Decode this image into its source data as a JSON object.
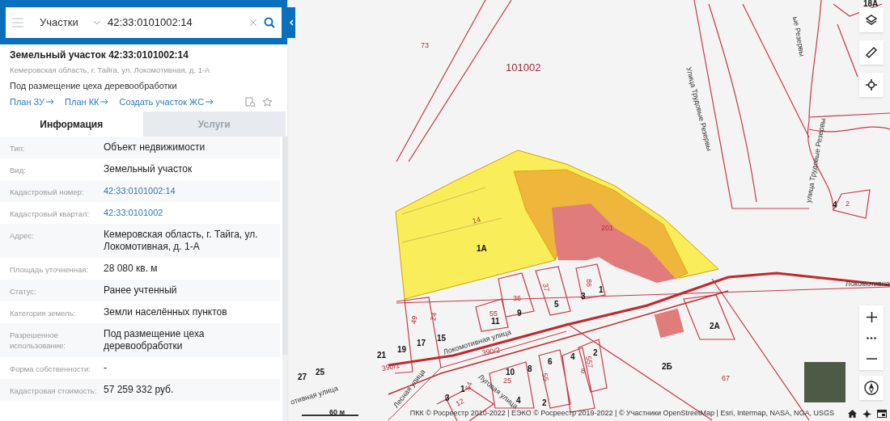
{
  "search": {
    "layer": "Участки",
    "value": "42:33:0101002:14"
  },
  "object": {
    "title": "Земельный участок 42:33:0101002:14",
    "address": "Кемеровская область, г. Тайга, ул. Локомотивная, д. 1-А",
    "purpose": "Под размещение цеха деревообработки",
    "links": [
      "План ЗУ",
      "План КК",
      "Создать участок ЖС"
    ]
  },
  "tabs": [
    {
      "label": "Информация",
      "selected": true
    },
    {
      "label": "Услуги",
      "selected": false
    }
  ],
  "details": [
    {
      "label": "Тип:",
      "value": "Объект недвижимости",
      "kind": "text"
    },
    {
      "label": "Вид:",
      "value": "Земельный участок",
      "kind": "text"
    },
    {
      "label": "Кадастровый номер:",
      "value": "42:33:0101002:14",
      "kind": "link"
    },
    {
      "label": "Кадастровый квартал:",
      "value": "42:33:0101002",
      "kind": "link"
    },
    {
      "label": "Адрес:",
      "value": "Кемеровская область, г. Тайга, ул. Локомотивная, д. 1-А",
      "kind": "text"
    },
    {
      "label": "Площадь уточненная:",
      "value": "28 080 кв. м",
      "kind": "text"
    },
    {
      "label": "Статус:",
      "value": "Ранее учтенный",
      "kind": "text"
    },
    {
      "label": "Категория земель:",
      "value": "Земли населённых пунктов",
      "kind": "text"
    },
    {
      "label": "Разрешенное использование:",
      "value": "Под размещение цеха деревообработки",
      "kind": "text"
    },
    {
      "label": "Форма собственности:",
      "value": "-",
      "kind": "text"
    },
    {
      "label": "Кадастровая стоимость:",
      "value": "57 259 332 руб.",
      "kind": "text"
    }
  ],
  "map": {
    "labels": [
      {
        "text": "73",
        "kind": "parcel"
      },
      {
        "text": "101002",
        "kind": "quarter"
      },
      {
        "text": "Улица Трудовые Резервы",
        "kind": "street"
      },
      {
        "text": "ые Резервы",
        "kind": "street"
      },
      {
        "text": "18А",
        "kind": "number"
      },
      {
        "text": "улица Трудовые Резервы",
        "kind": "street"
      },
      {
        "text": "4",
        "kind": "number"
      },
      {
        "text": "2",
        "kind": "parcel"
      },
      {
        "text": "14",
        "kind": "parcel"
      },
      {
        "text": "1А",
        "kind": "number"
      },
      {
        "text": "201",
        "kind": "parcel"
      },
      {
        "text": "37",
        "kind": "parcel"
      },
      {
        "text": "86",
        "kind": "parcel"
      },
      {
        "text": "1",
        "kind": "number"
      },
      {
        "text": "3",
        "kind": "number"
      },
      {
        "text": "5",
        "kind": "number"
      },
      {
        "text": "36",
        "kind": "parcel"
      },
      {
        "text": "9",
        "kind": "number"
      },
      {
        "text": "55",
        "kind": "parcel"
      },
      {
        "text": "11",
        "kind": "number"
      },
      {
        "text": "49",
        "kind": "parcel"
      },
      {
        "text": "24",
        "kind": "parcel"
      },
      {
        "text": "19",
        "kind": "number"
      },
      {
        "text": "17",
        "kind": "number"
      },
      {
        "text": "15",
        "kind": "number"
      },
      {
        "text": "21",
        "kind": "number"
      },
      {
        "text": "Локомотивная улица",
        "kind": "street"
      },
      {
        "text": "390/2",
        "kind": "parcel"
      },
      {
        "text": "Локомотивна",
        "kind": "street"
      },
      {
        "text": "2А",
        "kind": "number"
      },
      {
        "text": "2",
        "kind": "number"
      },
      {
        "text": "557",
        "kind": "parcel"
      },
      {
        "text": "27",
        "kind": "number"
      },
      {
        "text": "25",
        "kind": "number"
      },
      {
        "text": "390/1",
        "kind": "parcel"
      },
      {
        "text": "10",
        "kind": "number"
      },
      {
        "text": "25",
        "kind": "parcel"
      },
      {
        "text": "8",
        "kind": "number"
      },
      {
        "text": "6",
        "kind": "number"
      },
      {
        "text": "55",
        "kind": "parcel"
      },
      {
        "text": "4",
        "kind": "number"
      },
      {
        "text": "8",
        "kind": "parcel"
      },
      {
        "text": "2Б",
        "kind": "number"
      },
      {
        "text": "67",
        "kind": "parcel"
      },
      {
        "text": "Лесная улица",
        "kind": "street"
      },
      {
        "text": "Луговая улица",
        "kind": "street"
      },
      {
        "text": "1",
        "kind": "number"
      },
      {
        "text": "64",
        "kind": "parcel"
      },
      {
        "text": "3",
        "kind": "number"
      },
      {
        "text": "12",
        "kind": "parcel"
      },
      {
        "text": "4",
        "kind": "number"
      },
      {
        "text": "2",
        "kind": "number"
      },
      {
        "text": "отивная улица",
        "kind": "street"
      }
    ],
    "scale": "60 м",
    "attribution": "ПКК © Росреестр 2010-2022 | ЕЭКО © Росреестр 2019-2022 | © Участники OpenStreetMap | Esri, Intermap, NASA, NGA, USGS"
  }
}
